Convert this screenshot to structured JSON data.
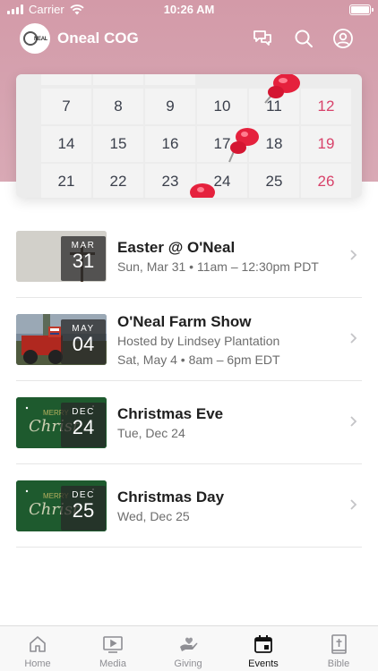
{
  "status_bar": {
    "carrier": "Carrier",
    "time": "10:26 AM"
  },
  "app_bar": {
    "title": "Oneal COG",
    "logo_text": "O'NEAL",
    "icons": [
      "chat-icon",
      "search-icon",
      "profile-icon"
    ]
  },
  "calendar": {
    "rows": [
      [
        "7",
        "8",
        "9",
        "10",
        "11",
        "12"
      ],
      [
        "14",
        "15",
        "16",
        "17",
        "18",
        "19"
      ],
      [
        "21",
        "22",
        "23",
        "24",
        "25",
        "26"
      ]
    ],
    "accent_color": "#d8426a"
  },
  "events": [
    {
      "title": "Easter @ O'Neal",
      "month": "MAR",
      "day": "31",
      "line1": "Sun, Mar 31 • 11am – 12:30pm PDT",
      "line2": ""
    },
    {
      "title": "O'Neal Farm Show",
      "month": "MAY",
      "day": "04",
      "line1": "Hosted by Lindsey Plantation",
      "line2": "Sat, May 4 • 8am – 6pm EDT"
    },
    {
      "title": "Christmas Eve",
      "month": "DEC",
      "day": "24",
      "line1": "Tue, Dec 24",
      "line2": ""
    },
    {
      "title": "Christmas Day",
      "month": "DEC",
      "day": "25",
      "line1": "Wed, Dec 25",
      "line2": ""
    }
  ],
  "tabs": [
    {
      "label": "Home",
      "icon": "home-icon",
      "active": false
    },
    {
      "label": "Media",
      "icon": "media-icon",
      "active": false
    },
    {
      "label": "Giving",
      "icon": "giving-icon",
      "active": false
    },
    {
      "label": "Events",
      "icon": "events-icon",
      "active": true
    },
    {
      "label": "Bible",
      "icon": "bible-icon",
      "active": false
    }
  ],
  "colors": {
    "header": "#d39aa8",
    "christmas_green": "#1e5a2e"
  }
}
